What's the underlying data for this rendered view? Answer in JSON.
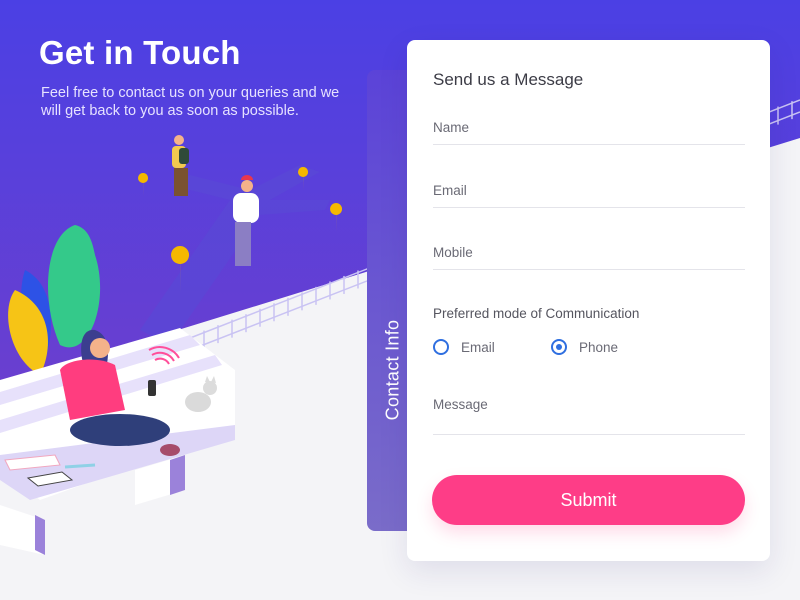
{
  "hero": {
    "title": "Get in Touch",
    "subtitle": "Feel free to contact us on your queries and we will get back to you as soon as possible."
  },
  "side_tab": {
    "label": "Contact Info"
  },
  "form": {
    "title": "Send us a Message",
    "fields": {
      "name": {
        "placeholder": "Name",
        "value": ""
      },
      "email": {
        "placeholder": "Email",
        "value": ""
      },
      "mobile": {
        "placeholder": "Mobile",
        "value": ""
      },
      "message": {
        "placeholder": "Message",
        "value": ""
      }
    },
    "preferred_label": "Preferred mode of Communication",
    "options": [
      {
        "label": "Email",
        "checked": false
      },
      {
        "label": "Phone",
        "checked": true
      }
    ],
    "submit_label": "Submit"
  },
  "colors": {
    "hero_bg": "#4e3fe0",
    "accent_pink": "#fe3d87",
    "radio_blue": "#2f6fe0",
    "tab_purple": "#6a57d2"
  }
}
